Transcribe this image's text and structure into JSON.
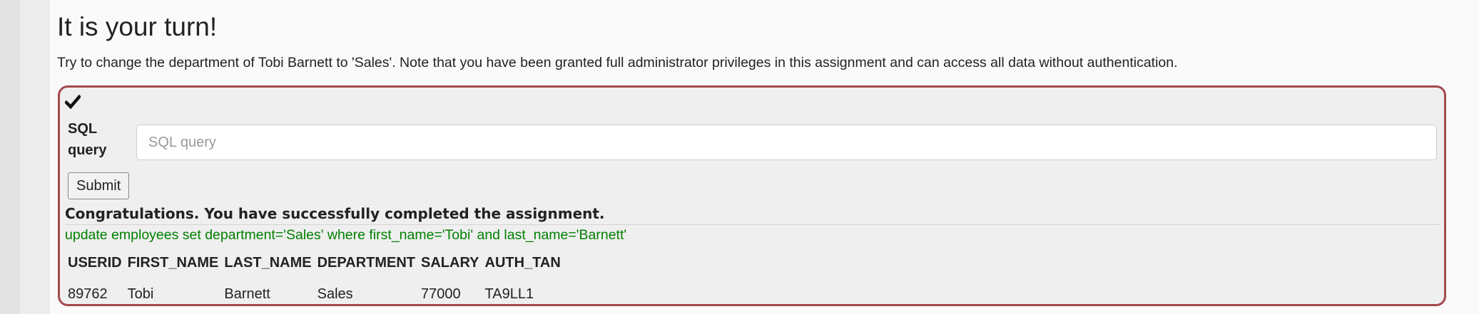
{
  "assignment": {
    "title": "It is your turn!",
    "description": "Try to change the department of Tobi Barnett to 'Sales'. Note that you have been granted full administrator privileges in this assignment and can access all data without authentication."
  },
  "form": {
    "status_icon": "check-icon",
    "sql_label": "SQL query",
    "sql_placeholder": "SQL query",
    "sql_value": "",
    "submit_label": "Submit"
  },
  "result": {
    "feedback": "Congratulations. You have successfully completed the assignment.",
    "output": "update employees set department='Sales' where first_name='Tobi' and last_name='Barnett'",
    "columns": [
      "USERID",
      "FIRST_NAME",
      "LAST_NAME",
      "DEPARTMENT",
      "SALARY",
      "AUTH_TAN"
    ],
    "rows": [
      [
        "89762",
        "Tobi",
        "Barnett",
        "Sales",
        "77000",
        "TA9LL1"
      ]
    ]
  },
  "colors": {
    "box_border": "#a44a4a",
    "output_text": "#008000"
  }
}
